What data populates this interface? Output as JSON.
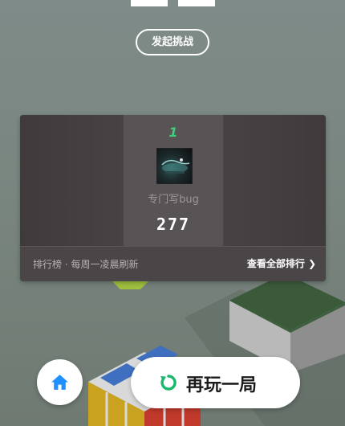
{
  "header": {
    "challenge_label": "发起挑战"
  },
  "leaderboard": {
    "entry": {
      "rank": "1",
      "name": "专门写bug",
      "score": "277"
    },
    "footer_note": "排行榜 · 每周一凌晨刷新",
    "view_all_label": "查看全部排行"
  },
  "actions": {
    "replay_label": "再玩一局"
  },
  "colors": {
    "rank_accent": "#3fcf7a",
    "home_icon": "#1e90ff",
    "replay_icon": "#19b86b"
  }
}
